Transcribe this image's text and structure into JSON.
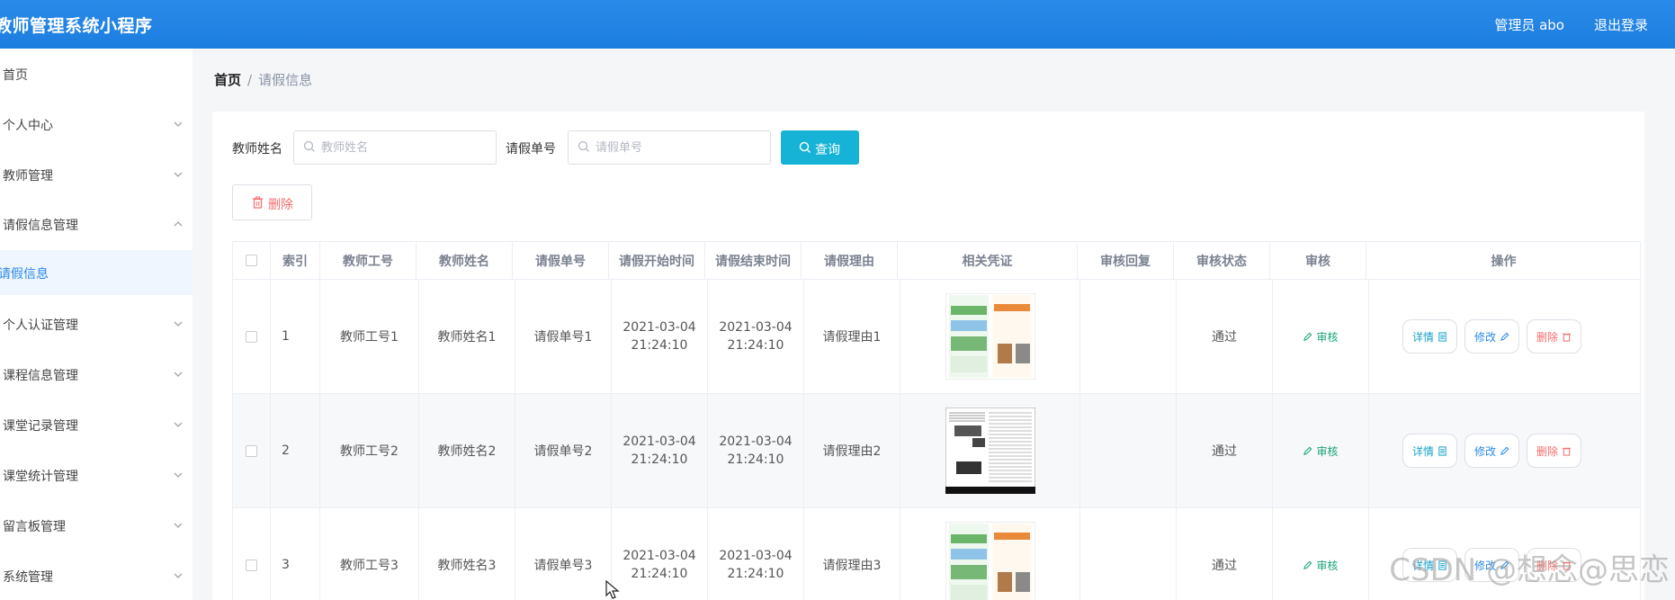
{
  "header": {
    "app_title": "教师管理系统小程序",
    "user_label": "管理员 abo",
    "logout_label": "退出登录"
  },
  "sidebar": {
    "items": [
      {
        "label": "首页",
        "chevron": "none"
      },
      {
        "label": "个人中心",
        "chevron": "down"
      },
      {
        "label": "教师管理",
        "chevron": "down"
      },
      {
        "label": "请假信息管理",
        "chevron": "up"
      },
      {
        "label": "请假信息",
        "chevron": "none",
        "active": true
      },
      {
        "label": "个人认证管理",
        "chevron": "down"
      },
      {
        "label": "课程信息管理",
        "chevron": "down"
      },
      {
        "label": "课堂记录管理",
        "chevron": "down"
      },
      {
        "label": "课堂统计管理",
        "chevron": "down"
      },
      {
        "label": "留言板管理",
        "chevron": "down"
      },
      {
        "label": "系统管理",
        "chevron": "down"
      }
    ]
  },
  "breadcrumb": {
    "home": "首页",
    "separator": "/",
    "current": "请假信息"
  },
  "search": {
    "teacher_name_label": "教师姓名",
    "teacher_name_placeholder": "教师姓名",
    "teacher_name_value": "",
    "leave_no_label": "请假单号",
    "leave_no_placeholder": "请假单号",
    "leave_no_value": "",
    "query_label": "查询"
  },
  "toolbar": {
    "delete_label": "删除"
  },
  "table": {
    "columns": [
      "",
      "索引",
      "教师工号",
      "教师姓名",
      "请假单号",
      "请假开始时间",
      "请假结束时间",
      "请假理由",
      "相关凭证",
      "审核回复",
      "审核状态",
      "审核",
      "操作"
    ],
    "rows": [
      {
        "index": "1",
        "teacher_id": "教师工号1",
        "teacher_name": "教师姓名1",
        "leave_no": "请假单号1",
        "start_date": "2021-03-04",
        "start_time": "21:24:10",
        "end_date": "2021-03-04",
        "end_time": "21:24:10",
        "reason": "请假理由1",
        "reply": "",
        "status": "通过",
        "thumb": "newspaper"
      },
      {
        "index": "2",
        "teacher_id": "教师工号2",
        "teacher_name": "教师姓名2",
        "leave_no": "请假单号2",
        "start_date": "2021-03-04",
        "start_time": "21:24:10",
        "end_date": "2021-03-04",
        "end_time": "21:24:10",
        "reason": "请假理由2",
        "reply": "",
        "status": "通过",
        "thumb": "document"
      },
      {
        "index": "3",
        "teacher_id": "教师工号3",
        "teacher_name": "教师姓名3",
        "leave_no": "请假单号3",
        "start_date": "2021-03-04",
        "start_time": "21:24:10",
        "end_date": "2021-03-04",
        "end_time": "21:24:10",
        "reason": "请假理由3",
        "reply": "",
        "status": "通过",
        "thumb": "newspaper"
      }
    ],
    "audit_label": "审核",
    "detail_label": "详情",
    "edit_label": "修改",
    "delete_label": "删除"
  },
  "watermark": "CSDN @想念@思恋",
  "colors": {
    "header": "#1c7ee0",
    "query_button": "#17b3d6",
    "delete_text": "#f56c6c",
    "audit_text": "#19a37a",
    "active_nav": "#2a8ae8"
  }
}
